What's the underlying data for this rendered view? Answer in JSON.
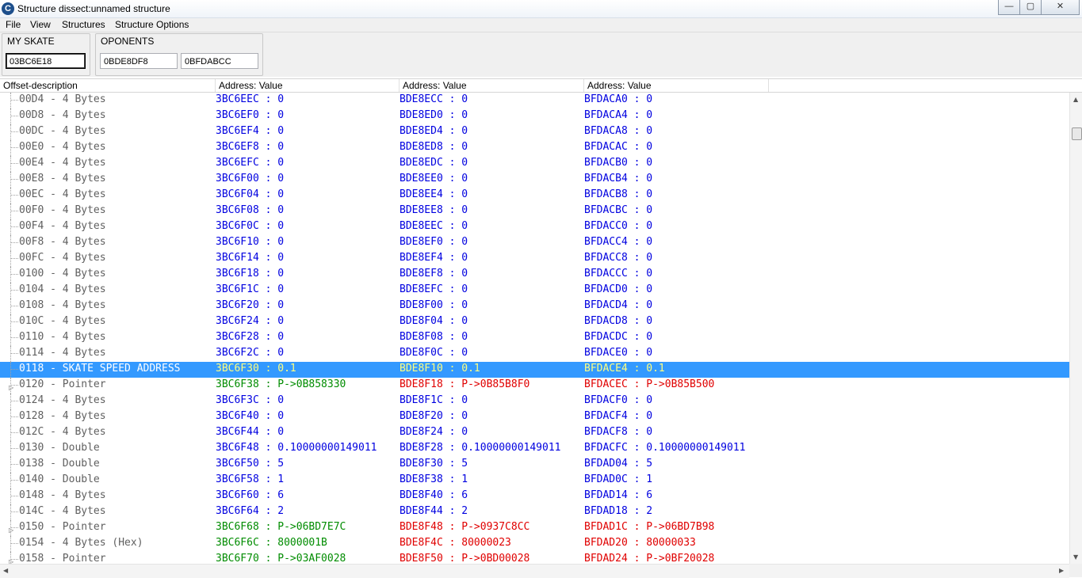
{
  "window": {
    "title": "Structure dissect:unnamed structure",
    "app_icon": "C",
    "min": "—",
    "max": "▢",
    "close": "✕"
  },
  "menu": {
    "file": "File",
    "view": "View",
    "structures": "Structures",
    "options": "Structure Options"
  },
  "groups": {
    "my_skate": {
      "label": "MY SKATE",
      "address": "03BC6E18"
    },
    "oponents": {
      "label": "OPONENTS",
      "address_1": "0BDE8DF8",
      "address_2": "0BFDABCC"
    }
  },
  "header": {
    "offset": "Offset-description",
    "col1": "Address: Value",
    "col2": "Address: Value",
    "col3": "Address: Value"
  },
  "colors": {
    "blue": "#0000e0",
    "green": "#008c00",
    "red": "#e00000",
    "yellow": "#ffff80",
    "gray": "#606060",
    "selection": "#3399ff",
    "white": "#ffffff"
  },
  "rows": [
    {
      "desc": "00D4 - 4 Bytes",
      "c1": "3BC6EEC : 0",
      "c2": "BDE8ECC : 0",
      "c3": "BFDACA0 : 0",
      "type": "b"
    },
    {
      "desc": "00D8 - 4 Bytes",
      "c1": "3BC6EF0 : 0",
      "c2": "BDE8ED0 : 0",
      "c3": "BFDACA4 : 0",
      "type": "b"
    },
    {
      "desc": "00DC - 4 Bytes",
      "c1": "3BC6EF4 : 0",
      "c2": "BDE8ED4 : 0",
      "c3": "BFDACA8 : 0",
      "type": "b"
    },
    {
      "desc": "00E0 - 4 Bytes",
      "c1": "3BC6EF8 : 0",
      "c2": "BDE8ED8 : 0",
      "c3": "BFDACAC : 0",
      "type": "b"
    },
    {
      "desc": "00E4 - 4 Bytes",
      "c1": "3BC6EFC : 0",
      "c2": "BDE8EDC : 0",
      "c3": "BFDACB0 : 0",
      "type": "b"
    },
    {
      "desc": "00E8 - 4 Bytes",
      "c1": "3BC6F00 : 0",
      "c2": "BDE8EE0 : 0",
      "c3": "BFDACB4 : 0",
      "type": "b"
    },
    {
      "desc": "00EC - 4 Bytes",
      "c1": "3BC6F04 : 0",
      "c2": "BDE8EE4 : 0",
      "c3": "BFDACB8 : 0",
      "type": "b"
    },
    {
      "desc": "00F0 - 4 Bytes",
      "c1": "3BC6F08 : 0",
      "c2": "BDE8EE8 : 0",
      "c3": "BFDACBC : 0",
      "type": "b"
    },
    {
      "desc": "00F4 - 4 Bytes",
      "c1": "3BC6F0C : 0",
      "c2": "BDE8EEC : 0",
      "c3": "BFDACC0 : 0",
      "type": "b"
    },
    {
      "desc": "00F8 - 4 Bytes",
      "c1": "3BC6F10 : 0",
      "c2": "BDE8EF0 : 0",
      "c3": "BFDACC4 : 0",
      "type": "b"
    },
    {
      "desc": "00FC - 4 Bytes",
      "c1": "3BC6F14 : 0",
      "c2": "BDE8EF4 : 0",
      "c3": "BFDACC8 : 0",
      "type": "b"
    },
    {
      "desc": "0100 - 4 Bytes",
      "c1": "3BC6F18 : 0",
      "c2": "BDE8EF8 : 0",
      "c3": "BFDACCC : 0",
      "type": "b"
    },
    {
      "desc": "0104 - 4 Bytes",
      "c1": "3BC6F1C : 0",
      "c2": "BDE8EFC : 0",
      "c3": "BFDACD0 : 0",
      "type": "b"
    },
    {
      "desc": "0108 - 4 Bytes",
      "c1": "3BC6F20 : 0",
      "c2": "BDE8F00 : 0",
      "c3": "BFDACD4 : 0",
      "type": "b"
    },
    {
      "desc": "010C - 4 Bytes",
      "c1": "3BC6F24 : 0",
      "c2": "BDE8F04 : 0",
      "c3": "BFDACD8 : 0",
      "type": "b"
    },
    {
      "desc": "0110 - 4 Bytes",
      "c1": "3BC6F28 : 0",
      "c2": "BDE8F08 : 0",
      "c3": "BFDACDC : 0",
      "type": "b"
    },
    {
      "desc": "0114 - 4 Bytes",
      "c1": "3BC6F2C : 0",
      "c2": "BDE8F0C : 0",
      "c3": "BFDACE0 : 0",
      "type": "b"
    },
    {
      "desc": "0118 - SKATE SPEED ADDRESS",
      "c1": "3BC6F30 : 0.1",
      "c2": "BDE8F10 : 0.1",
      "c3": "BFDACE4 : 0.1",
      "type": "sel"
    },
    {
      "desc": "0120 - Pointer",
      "c1": "3BC6F38 : P->0B858330",
      "c2": "BDE8F18 : P->0B85B8F0",
      "c3": "BFDACEC : P->0B85B500",
      "type": "p"
    },
    {
      "desc": "0124 - 4 Bytes",
      "c1": "3BC6F3C : 0",
      "c2": "BDE8F1C : 0",
      "c3": "BFDACF0 : 0",
      "type": "b"
    },
    {
      "desc": "0128 - 4 Bytes",
      "c1": "3BC6F40 : 0",
      "c2": "BDE8F20 : 0",
      "c3": "BFDACF4 : 0",
      "type": "b"
    },
    {
      "desc": "012C - 4 Bytes",
      "c1": "3BC6F44 : 0",
      "c2": "BDE8F24 : 0",
      "c3": "BFDACF8 : 0",
      "type": "b"
    },
    {
      "desc": "0130 - Double",
      "c1": "3BC6F48 : 0.10000000149011",
      "c2": "BDE8F28 : 0.10000000149011",
      "c3": "BFDACFC : 0.10000000149011",
      "type": "b"
    },
    {
      "desc": "0138 - Double",
      "c1": "3BC6F50 : 5",
      "c2": "BDE8F30 : 5",
      "c3": "BFDAD04 : 5",
      "type": "b"
    },
    {
      "desc": "0140 - Double",
      "c1": "3BC6F58 : 1",
      "c2": "BDE8F38 : 1",
      "c3": "BFDAD0C : 1",
      "type": "b"
    },
    {
      "desc": "0148 - 4 Bytes",
      "c1": "3BC6F60 : 6",
      "c2": "BDE8F40 : 6",
      "c3": "BFDAD14 : 6",
      "type": "b"
    },
    {
      "desc": "014C - 4 Bytes",
      "c1": "3BC6F64 : 2",
      "c2": "BDE8F44 : 2",
      "c3": "BFDAD18 : 2",
      "type": "b"
    },
    {
      "desc": "0150 - Pointer",
      "c1": "3BC6F68 : P->06BD7E7C",
      "c2": "BDE8F48 : P->0937C8CC",
      "c3": "BFDAD1C : P->06BD7B98",
      "type": "p"
    },
    {
      "desc": "0154 - 4 Bytes (Hex)",
      "c1": "3BC6F6C : 8000001B",
      "c2": "BDE8F4C : 80000023",
      "c3": "BFDAD20 : 80000033",
      "type": "h"
    },
    {
      "desc": "0158 - Pointer",
      "c1": "3BC6F70 : P->03AF0028",
      "c2": "BDE8F50 : P->0BD00028",
      "c3": "BFDAD24 : P->0BF20028",
      "type": "p"
    }
  ]
}
